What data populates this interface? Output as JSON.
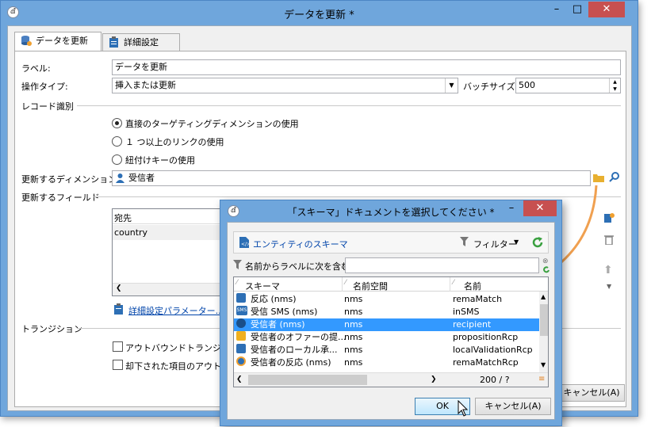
{
  "main_window": {
    "title": "データを更新 *",
    "minimize": "–",
    "maximize": "□",
    "close": "✕",
    "tabs": [
      "データを更新",
      "詳細設定"
    ],
    "label_caption": "ラベル:",
    "label_value": "データを更新",
    "op_type_caption": "操作タイプ:",
    "op_type_value": "挿入または更新",
    "batch_caption": "バッチサイズ:",
    "batch_value": "500",
    "record_id_section": "レコード識別",
    "radios": [
      "直接のターゲティングディメンションの使用",
      "１ つ以上のリンクの使用",
      "紐付けキーの使用"
    ],
    "selected_radio": 0,
    "dimension_caption": "更新するディメンション:",
    "dimension_value": "受信者",
    "fields_section": "更新するフィールド",
    "fields_list": [
      "宛先",
      "country"
    ],
    "advanced_link": "詳細設定パラメーター...",
    "transition_section": "トランジション",
    "checkboxes": [
      "アウトバウンドトランジション",
      "却下された項目のアウトバ"
    ],
    "cancel_button": "キャンセル(A)"
  },
  "dialog": {
    "title": "「スキーマ」ドキュメントを選択してください *",
    "minimize": "–",
    "close": "✕",
    "toolbar_title": "エンティティのスキーマ",
    "filter_label": "フィルター",
    "search_caption": "名前からラベルに次を含む:",
    "search_value": "",
    "columns": [
      "スキーマ",
      "名前空間",
      "名前"
    ],
    "rows": [
      {
        "schema": "反応 (nms)",
        "ns": "nms",
        "name": "remaMatch"
      },
      {
        "schema": "受信 SMS (nms)",
        "ns": "nms",
        "name": "inSMS"
      },
      {
        "schema": "受信者 (nms)",
        "ns": "nms",
        "name": "recipient"
      },
      {
        "schema": "受信者のオファーの提...",
        "ns": "nms",
        "name": "propositionRcp"
      },
      {
        "schema": "受信者のローカル承...",
        "ns": "nms",
        "name": "localValidationRcp"
      },
      {
        "schema": "受信者の反応 (nms)",
        "ns": "nms",
        "name": "remaMatchRcp"
      }
    ],
    "selected_row": 2,
    "count": "200 / ?",
    "ok_button": "OK",
    "cancel_button": "キャンセル(A)"
  },
  "colors": {
    "title_bar": "#6fa6dc",
    "selection": "#3399ff",
    "close": "#c75050",
    "link": "#0044aa",
    "accent_arrow": "#f0a050"
  }
}
